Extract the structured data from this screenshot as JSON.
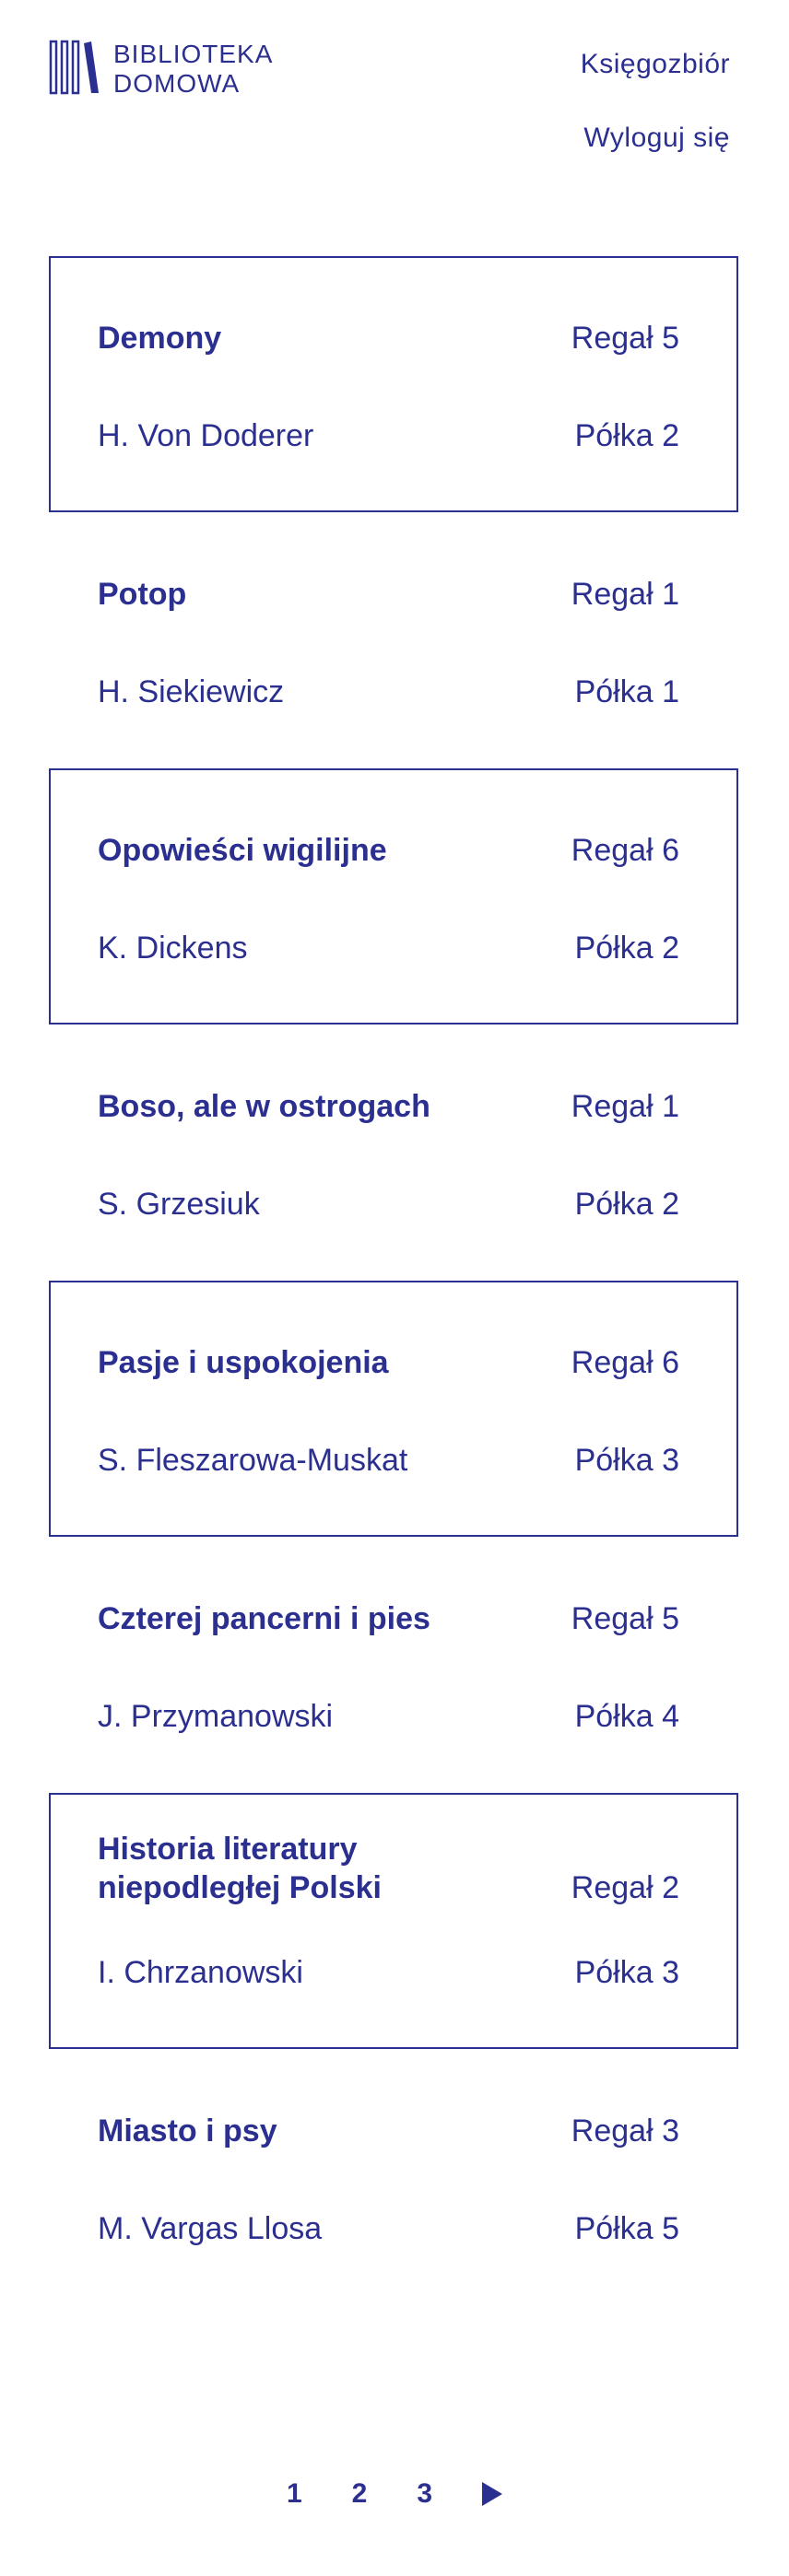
{
  "header": {
    "logo": {
      "line1": "BIBLIOTEKA",
      "line2": "DOMOWA",
      "icon": "books-icon"
    },
    "nav": [
      {
        "label": "Księgozbiór"
      },
      {
        "label": "Wyloguj się"
      }
    ]
  },
  "books": [
    {
      "title": "Demony",
      "author": "H. Von Doderer",
      "rack": "Regał 5",
      "shelf": "Półka 2"
    },
    {
      "title": "Potop",
      "author": "H. Siekiewicz",
      "rack": "Regał 1",
      "shelf": "Półka 1"
    },
    {
      "title": "Opowieści wigilijne",
      "author": "K. Dickens",
      "rack": "Regał 6",
      "shelf": "Półka 2"
    },
    {
      "title": "Boso, ale w ostrogach",
      "author": "S. Grzesiuk",
      "rack": "Regał 1",
      "shelf": "Półka 2"
    },
    {
      "title": "Pasje i uspokojenia",
      "author": "S. Fleszarowa-Muskat",
      "rack": "Regał 6",
      "shelf": "Półka 3"
    },
    {
      "title": "Czterej pancerni i pies",
      "author": "J. Przymanowski",
      "rack": "Regał 5",
      "shelf": "Półka 4"
    },
    {
      "title": "Historia literatury niepodległej Polski",
      "author": "I. Chrzanowski",
      "rack": "Regał 2",
      "shelf": "Półka 3"
    },
    {
      "title": "Miasto i psy",
      "author": "M. Vargas Llosa",
      "rack": "Regał 3",
      "shelf": "Półka 5"
    }
  ],
  "pagination": {
    "pages": [
      "1",
      "2",
      "3"
    ],
    "next_icon": "play-right-icon"
  },
  "colors": {
    "accent": "#2b2f8f",
    "background": "#ffffff"
  }
}
